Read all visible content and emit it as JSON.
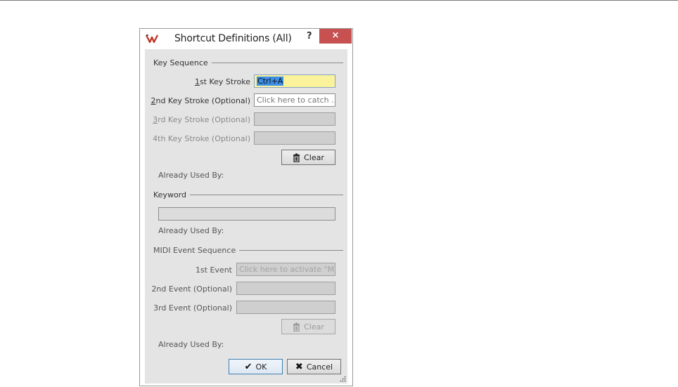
{
  "window": {
    "title": "Shortcut Definitions (All)",
    "help_glyph": "?",
    "close_glyph": "×"
  },
  "key_sequence": {
    "section_title": "Key Sequence",
    "stroke1": {
      "label_ul": "1",
      "label_rest": "st Key Stroke",
      "value": "Ctrl+A"
    },
    "stroke2": {
      "label_ul": "2",
      "label_rest": "nd Key Stroke (Optional)",
      "placeholder": "Click here to catch ..."
    },
    "stroke3": {
      "label_ul": "3",
      "label_rest": "rd Key Stroke (Optional)"
    },
    "stroke4": {
      "label": "4th Key Stroke (Optional)"
    },
    "clear_label": "Clear",
    "already_used": "Already Used By:"
  },
  "keyword": {
    "section_title": "Keyword",
    "already_used": "Already Used By:"
  },
  "midi": {
    "section_title": "MIDI Event Sequence",
    "event1": {
      "label": "1st Event",
      "placeholder": "Click here to activate \"M..."
    },
    "event2": {
      "label": "2nd Event (Optional)"
    },
    "event3": {
      "label": "3rd Event (Optional)"
    },
    "clear_label": "Clear",
    "already_used": "Already Used By:"
  },
  "footer": {
    "ok_label": "OK",
    "cancel_label": "Cancel"
  }
}
